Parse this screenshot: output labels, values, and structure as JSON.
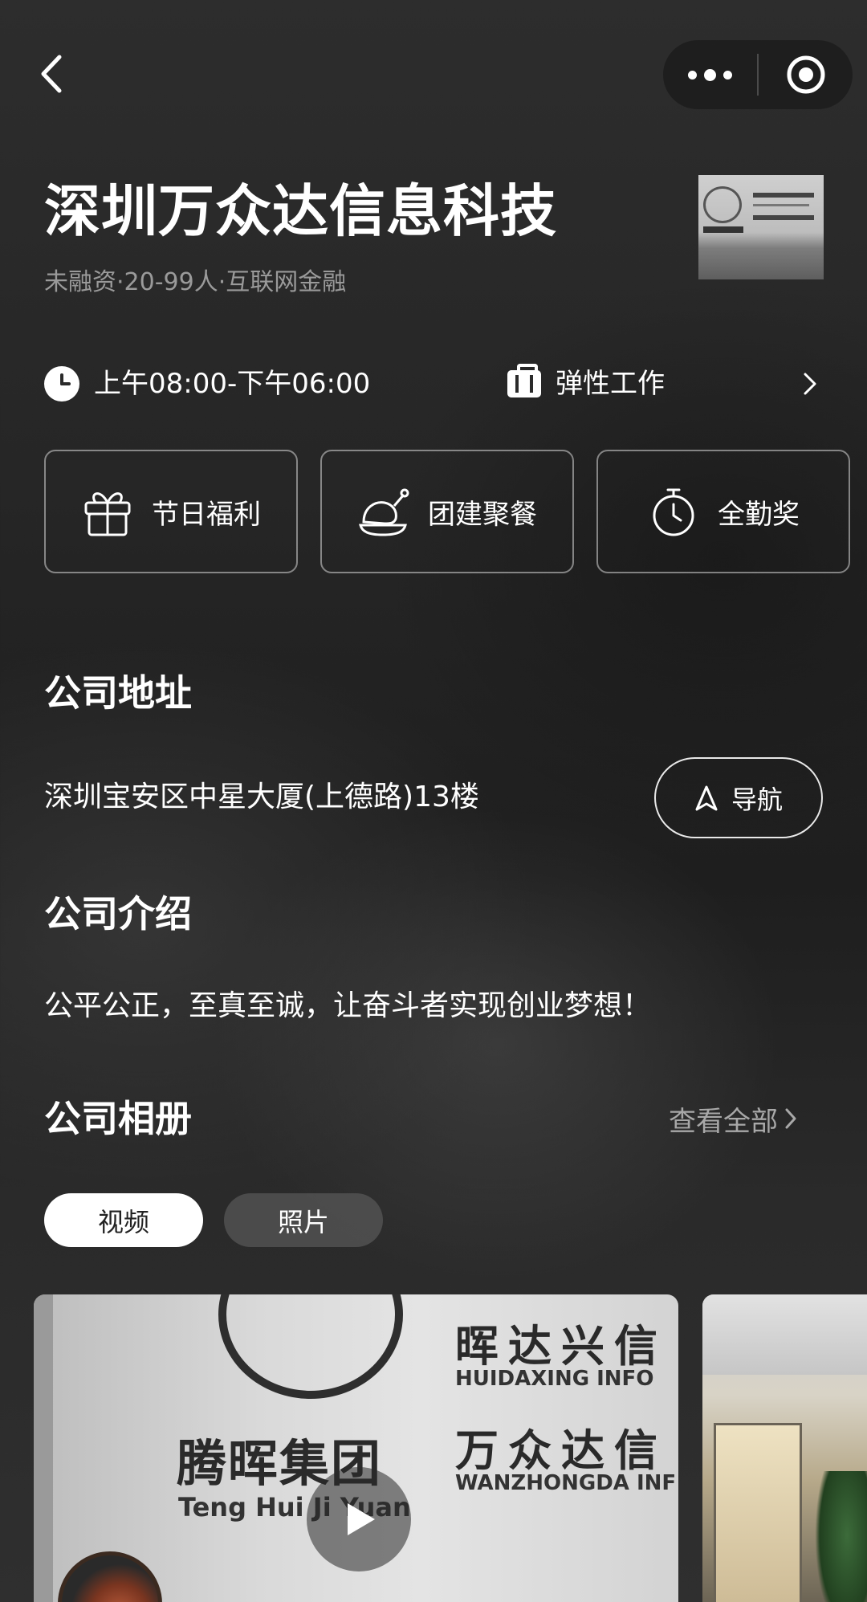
{
  "header": {
    "back_icon": "chevron-left-icon",
    "more_icon": "more-dots-icon",
    "close_icon": "target-circle-icon"
  },
  "company": {
    "name": "深圳万众达信息科技",
    "meta": "未融资·20-99人·互联网金融"
  },
  "work": {
    "hours": "上午08:00-下午06:00",
    "mode": "弹性工作"
  },
  "benefits": [
    {
      "label": "节日福利",
      "icon": "gift-icon"
    },
    {
      "label": "团建聚餐",
      "icon": "roast-chicken-icon"
    },
    {
      "label": "全勤奖",
      "icon": "stopwatch-icon"
    }
  ],
  "address_section": {
    "title": "公司地址",
    "address": "深圳宝安区中星大厦(上德路)13楼",
    "nav_label": "导航"
  },
  "intro_section": {
    "title": "公司介绍",
    "text": "公平公正，至真至诚，让奋斗者实现创业梦想！"
  },
  "album_section": {
    "title": "公司相册",
    "view_all": "查看全部",
    "tabs": [
      {
        "label": "视频",
        "active": true
      },
      {
        "label": "照片",
        "active": false
      }
    ]
  },
  "media": {
    "group_cn": "腾晖集团",
    "group_en": "Teng Hui Ji Yuan",
    "company1_cn": "晖达兴信",
    "company1_en": "HUIDAXING INFO",
    "company2_cn": "万众达信",
    "company2_en": "WANZHONGDA INF"
  },
  "colors": {
    "background": "#262626",
    "text": "#ffffff",
    "muted": "#9a9a9a",
    "active_pill": "#ffffff"
  }
}
